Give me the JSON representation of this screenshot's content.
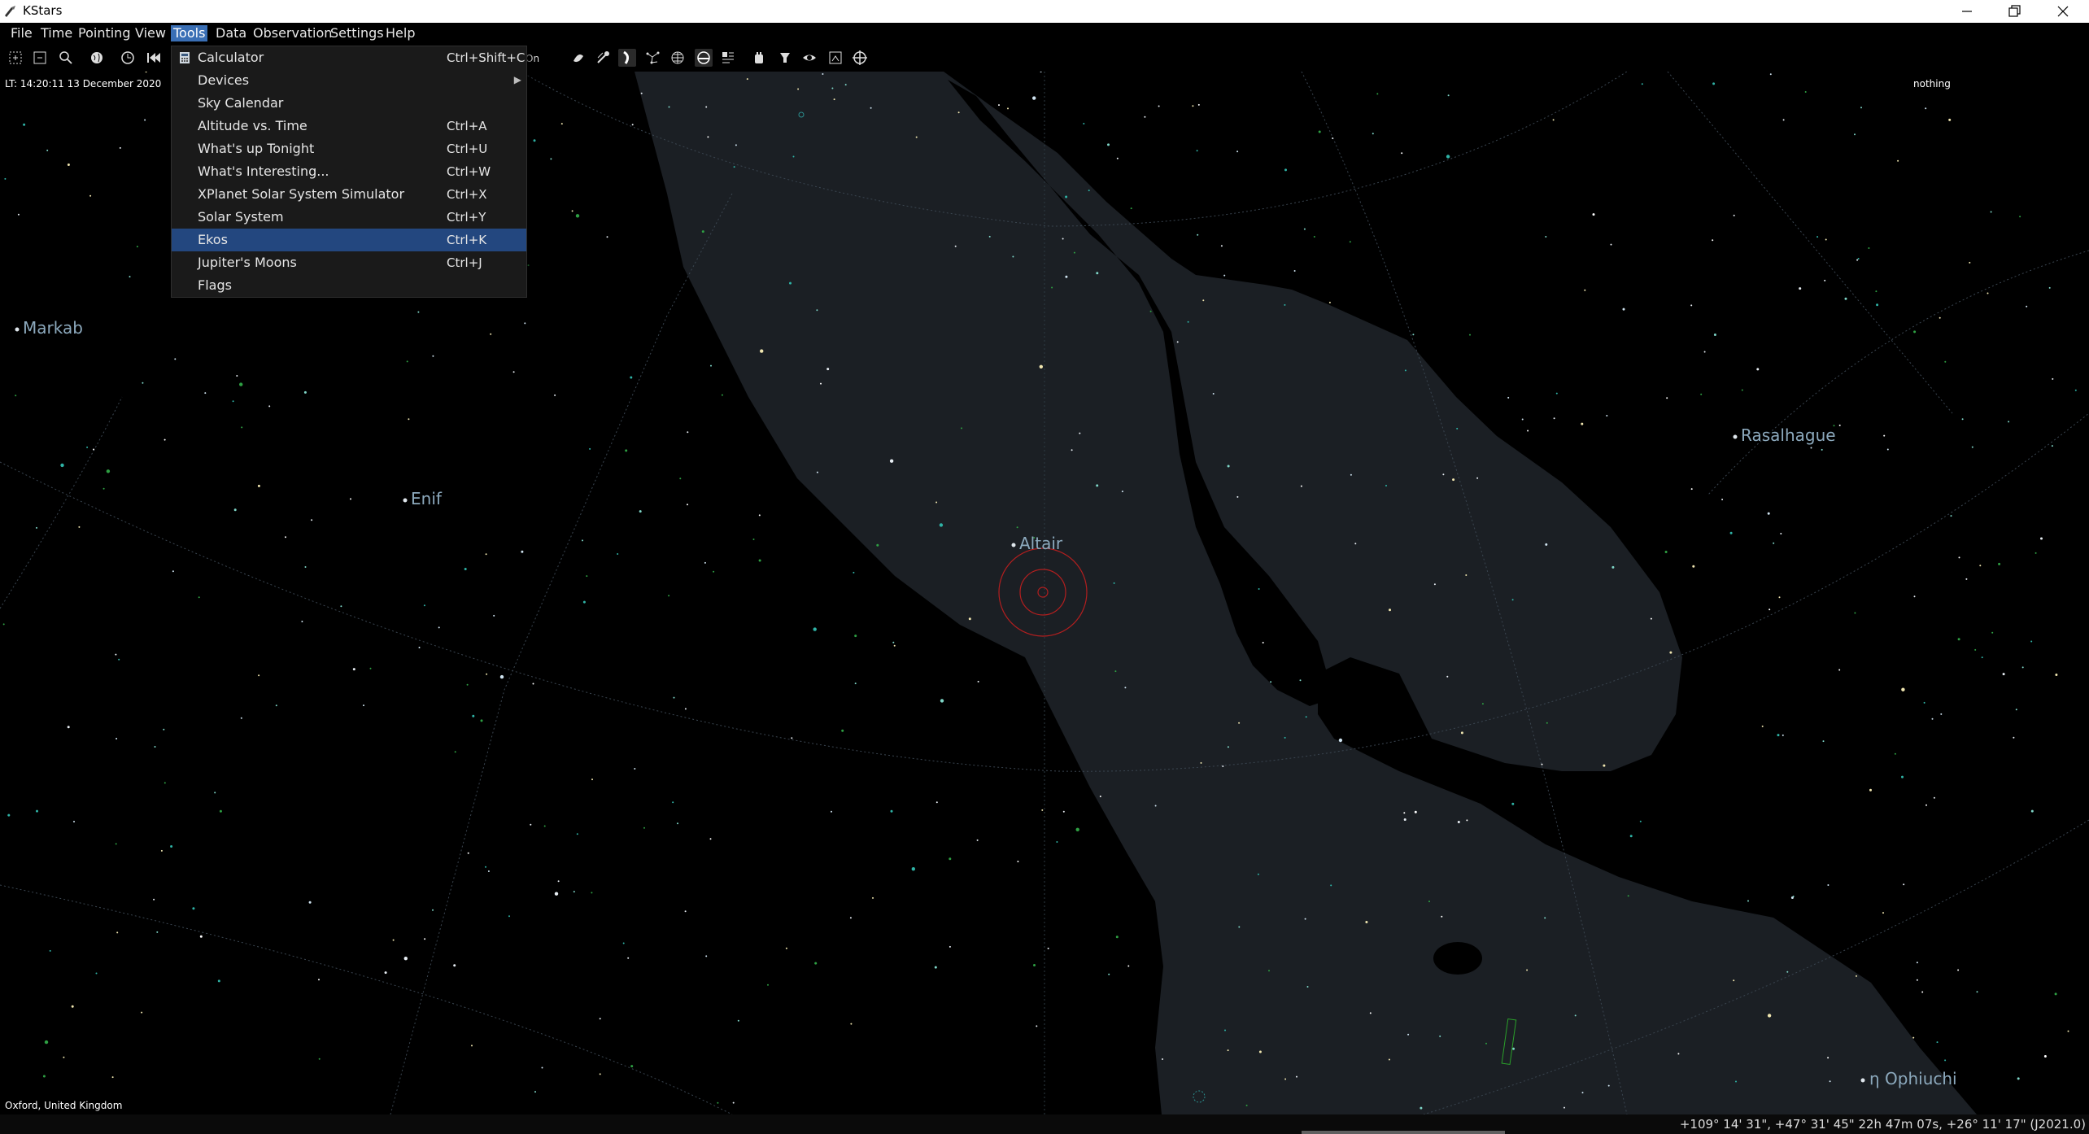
{
  "window": {
    "title": "KStars"
  },
  "menubar": {
    "items": [
      {
        "label": "File"
      },
      {
        "label": "Time"
      },
      {
        "label": "Pointing"
      },
      {
        "label": "View"
      },
      {
        "label": "Tools"
      },
      {
        "label": "Data"
      },
      {
        "label": "Observation"
      },
      {
        "label": "Settings"
      },
      {
        "label": "Help"
      }
    ],
    "active": "Tools"
  },
  "tools_menu": {
    "items": [
      {
        "label": "Calculator",
        "shortcut": "Ctrl+Shift+C",
        "icon": "calculator-icon"
      },
      {
        "label": "Devices",
        "shortcut": "",
        "submenu": true
      },
      {
        "label": "Sky Calendar",
        "shortcut": ""
      },
      {
        "label": "Altitude vs. Time",
        "shortcut": "Ctrl+A"
      },
      {
        "label": "What's up Tonight",
        "shortcut": "Ctrl+U"
      },
      {
        "label": "What's Interesting...",
        "shortcut": "Ctrl+W"
      },
      {
        "label": "XPlanet Solar System Simulator",
        "shortcut": "Ctrl+X"
      },
      {
        "label": "Solar System",
        "shortcut": "Ctrl+Y"
      },
      {
        "label": "Ekos",
        "shortcut": "Ctrl+K",
        "highlighted": true
      },
      {
        "label": "Jupiter's Moons",
        "shortcut": "Ctrl+J"
      },
      {
        "label": "Flags",
        "shortcut": ""
      }
    ]
  },
  "sky": {
    "time_text": "LT: 14:20:11   13 December 2020",
    "focus_text": "nothing",
    "location_text": "Oxford, United Kingdom",
    "labels": {
      "markab": "Markab",
      "enif": "Enif",
      "altair": "Altair",
      "rasalhague": "Rasalhague",
      "eta_ophiuchi": "η Ophiuchi"
    }
  },
  "statusbar": {
    "coords": "+109° 14' 31\", +47° 31' 45\"  22h 47m 07s, +26° 11' 17\" (J2021.0)"
  },
  "colors": {
    "menu_highlight": "#23477f",
    "milky_way": "#1b1f24",
    "target_circle": "#b21f1f",
    "star_label": "#8ca9bd"
  }
}
